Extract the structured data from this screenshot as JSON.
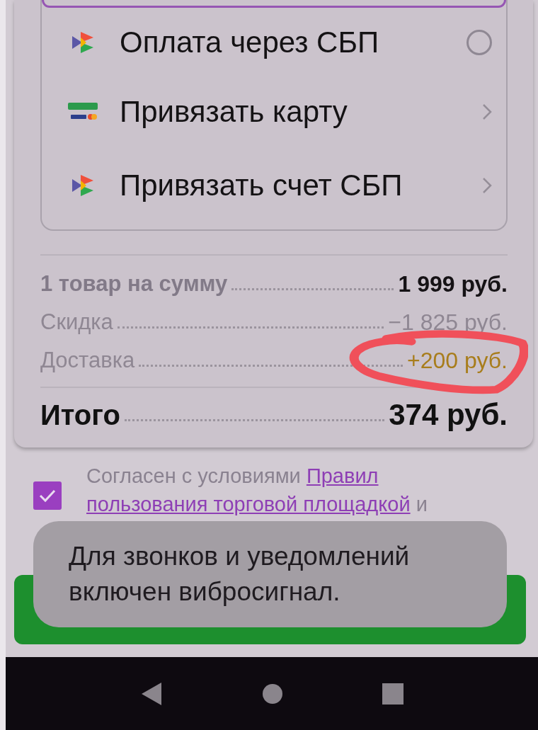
{
  "payment_methods": [
    {
      "kind": "radio",
      "label": "Оплата через СБП",
      "selected": false
    },
    {
      "kind": "link",
      "label": "Привязать карту"
    },
    {
      "kind": "link",
      "label": "Привязать счет СБП"
    }
  ],
  "summary": [
    {
      "kind": "subtotal",
      "label": "1 товар на сумму",
      "value": "1 999 руб."
    },
    {
      "kind": "discount",
      "label": "Скидка",
      "value": "−1 825 руб."
    },
    {
      "kind": "delivery",
      "label": "Доставка",
      "value": "+200 руб."
    }
  ],
  "total": {
    "label": "Итого",
    "value": "374 руб."
  },
  "agreement": {
    "checked": true,
    "parts": [
      {
        "kind": "plain",
        "text": "Согласен с условиями "
      },
      {
        "kind": "link",
        "text": "Правил"
      },
      {
        "kind": "link",
        "text": "пользования торговой площадкой"
      },
      {
        "kind": "plain",
        "text": " и"
      }
    ]
  },
  "toast": "Для звонков и уведомлений включен вибросигнал."
}
